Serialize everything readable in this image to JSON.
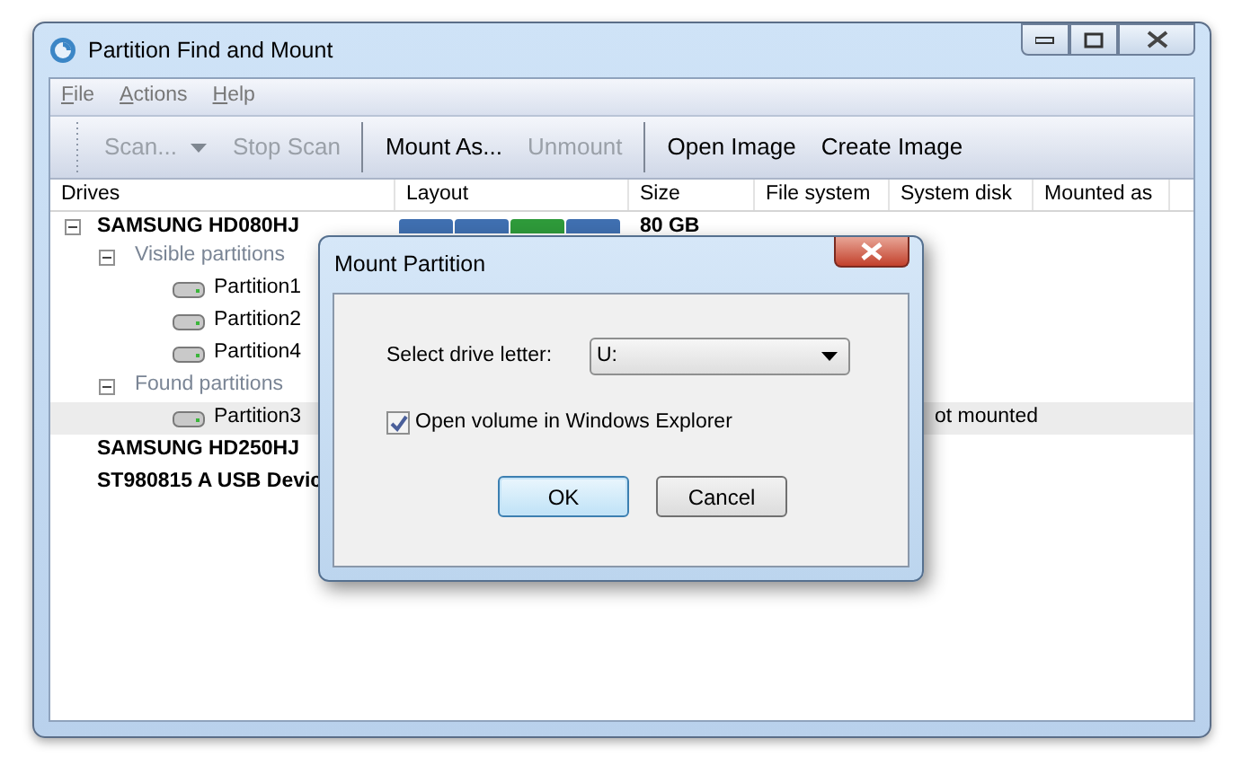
{
  "window": {
    "title": "Partition Find and Mount"
  },
  "menu": [
    "File",
    "Actions",
    "Help"
  ],
  "toolbar": [
    {
      "kind": "dropdown",
      "label": "Scan...",
      "disabled": true
    },
    {
      "kind": "button",
      "label": "Stop Scan",
      "disabled": true
    },
    {
      "kind": "separator"
    },
    {
      "kind": "button",
      "label": "Mount As...",
      "disabled": false
    },
    {
      "kind": "button",
      "label": "Unmount",
      "disabled": true
    },
    {
      "kind": "separator"
    },
    {
      "kind": "button",
      "label": "Open Image",
      "disabled": false
    },
    {
      "kind": "button",
      "label": "Create Image",
      "disabled": false
    }
  ],
  "table": {
    "columns": [
      "Drives",
      "Layout",
      "Size",
      "File system",
      "System disk",
      "Mounted as"
    ],
    "rows": [
      {
        "kind": "drive",
        "name": "SAMSUNG HD080HJ",
        "expanded": true,
        "selected": false,
        "size": "80 GB",
        "layout": [
          {
            "color": "#3f6fb0"
          },
          {
            "color": "#3f6fb0"
          },
          {
            "color": "#2e9a3a"
          },
          {
            "color": "#3f6fb0"
          }
        ],
        "children": [
          {
            "kind": "group",
            "name": "Visible partitions",
            "expanded": true,
            "children": [
              {
                "kind": "partition",
                "name": "Partition1",
                "selected": false
              },
              {
                "kind": "partition",
                "name": "Partition2",
                "selected": false
              },
              {
                "kind": "partition",
                "name": "Partition4",
                "selected": false
              }
            ]
          },
          {
            "kind": "group",
            "name": "Found partitions",
            "expanded": true,
            "children": [
              {
                "kind": "partition",
                "name": "Partition3",
                "selected": true,
                "column_5": "ot mounted"
              }
            ]
          }
        ]
      },
      {
        "kind": "drive",
        "name": "SAMSUNG HD250HJ",
        "selected": false
      },
      {
        "kind": "drive",
        "name": "ST980815 A USB Devic",
        "selected": false
      }
    ]
  },
  "dialog": {
    "title": "Mount Partition",
    "label": "Select drive letter:",
    "value": "U:",
    "checkbox": {
      "label": "Open volume in Windows Explorer",
      "checked": true
    },
    "buttons": [
      {
        "label": "OK",
        "default": true
      },
      {
        "label": "Cancel",
        "default": false
      }
    ]
  }
}
